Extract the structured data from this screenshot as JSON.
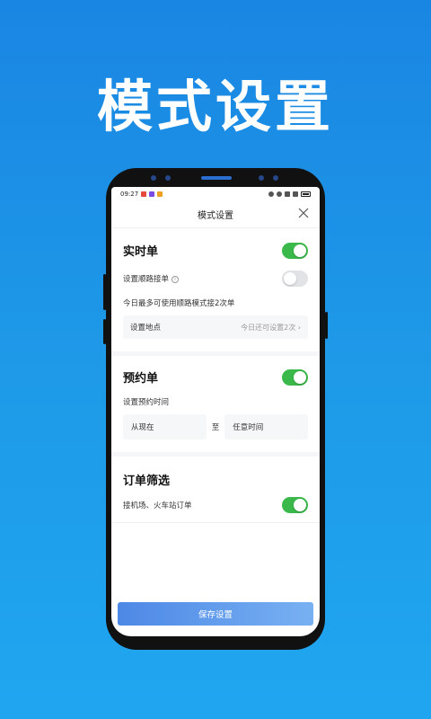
{
  "promo": {
    "title": "模式设置"
  },
  "status": {
    "time": "09:27"
  },
  "header": {
    "title": "模式设置"
  },
  "realtime": {
    "title": "实时单",
    "enabled": true,
    "route_label": "设置顺路接单",
    "route_enabled": false,
    "route_limit_text": "今日最多可使用顺路模式接2次单",
    "location_label": "设置地点",
    "location_hint": "今日还可设置2次"
  },
  "reserve": {
    "title": "预约单",
    "enabled": true,
    "time_label": "设置预约时间",
    "from": "从现在",
    "to_word": "至",
    "to": "任意时间"
  },
  "filter": {
    "title": "订单筛选",
    "airport_label": "接机场、火车站订单",
    "airport_enabled": true
  },
  "footer": {
    "save_label": "保存设置"
  },
  "colors": {
    "accent_green": "#3bb84a",
    "save_blue": "#4d88e6",
    "background_blue": "#1e9be8"
  }
}
